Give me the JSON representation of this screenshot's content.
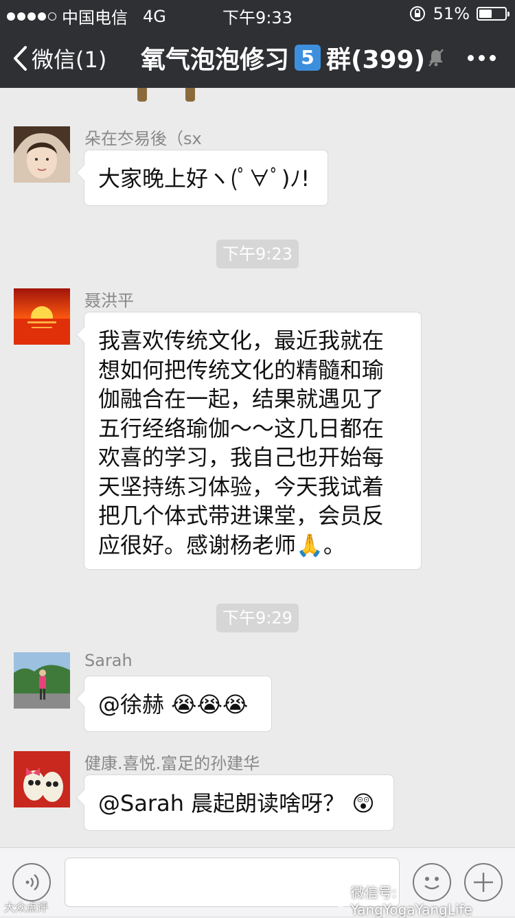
{
  "status": {
    "carrier": "中国电信",
    "network": "4G",
    "time": "下午9:33",
    "battery": "51%",
    "battery_level": 0.51,
    "signal_dots_filled": 4
  },
  "nav": {
    "back_label": "微信(1)",
    "title_pre": "氧气泡泡修习",
    "title_num": "5",
    "title_post": "群(399)"
  },
  "messages": [
    {
      "sender": "朵在冭易後（sx",
      "text": "大家晚上好ヽ(ﾟ∀ﾟ)ﾉ!"
    },
    {
      "sender": "聂洪平",
      "text": "我喜欢传统文化，最近我就在\n想如何把传统文化的精髓和瑜\n伽融合在一起，结果就遇见了\n五行经络瑜伽～～这几日都在\n欢喜的学习，我自己也开始每\n天坚持练习体验，今天我试着\n把几个体式带进课堂，会员反\n应很好。感谢杨老师🙏。"
    },
    {
      "sender": "Sarah",
      "text": "@徐赫 😭😭😭"
    },
    {
      "sender": "健康.喜悦.富足的孙建华",
      "text": "@Sarah 晨起朗读啥呀？ 😲"
    }
  ],
  "timestamps": [
    "下午9:23",
    "下午9:29"
  ],
  "watermark": {
    "left": "大众点评",
    "right": "微信号: YangYogaYangLife"
  },
  "colors": {
    "header_bg": "#2f3034",
    "chat_bg": "#ebebeb",
    "badge_blue": "#3d8fde"
  }
}
